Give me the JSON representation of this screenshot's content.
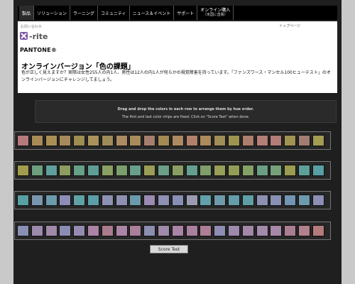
{
  "nav": {
    "items": [
      "製品",
      "ソリューション",
      "ラーニング",
      "コミュニティ",
      "ニュース＆イベント",
      "サポート"
    ],
    "shop_label": "オンライン購入",
    "shop_sub": "（米国に直販）"
  },
  "header": {
    "contact": "お問い合わせ",
    "top_link": "トップページ",
    "xrite_logo": "x·rite",
    "pantone_logo": "PANTONE®"
  },
  "intro": {
    "title": "オンラインバージョン「色の課題」",
    "body": "色が正しく見えますか？実際は女性255人の内1人、男性は12人の内1人が何らかの視覚障害を持っています。「ファンズワース・マンセル100ヒューテスト」のオンラインバージョンにチャレンジしてましょう。"
  },
  "instructions": {
    "line1": "Drag and drop the colors in each row to arrange them by hue order.",
    "line2": "The first and last color chips are fixed. Click on \"Score Test\" when done."
  },
  "rows": [
    [
      "#b57a7c",
      "#a98a56",
      "#a99052",
      "#a68a5c",
      "#9c8d50",
      "#a9935a",
      "#9e8b57",
      "#ac8b63",
      "#a78b5d",
      "#a77e6e",
      "#a38a52",
      "#ac8a5f",
      "#b27f6a",
      "#ab8a5b",
      "#a08e55",
      "#9e9450",
      "#ab7f6b",
      "#b47e74",
      "#b27c77",
      "#a19352",
      "#a27d73",
      "#a39c53"
    ],
    [
      "#a29d4e",
      "#6d9f7f",
      "#5fa09d",
      "#8c9d5f",
      "#67a089",
      "#5f9e95",
      "#8b9f62",
      "#7b9e6d",
      "#68a08b",
      "#9a9d55",
      "#6b9f86",
      "#8a9e63",
      "#64a090",
      "#7f9f6a",
      "#969f57",
      "#949d57",
      "#83a067",
      "#6b9f84",
      "#75a07a",
      "#9b9d50",
      "#5e9f97",
      "#58a0a3"
    ],
    [
      "#58a0a3",
      "#7996b1",
      "#6a9bac",
      "#8d8db7",
      "#5ea2a6",
      "#5a9ea9",
      "#8c91b4",
      "#8d91b1",
      "#6c9aad",
      "#9b8ab2",
      "#8e90b4",
      "#878fb5",
      "#999cb1",
      "#62a0ab",
      "#6e9aac",
      "#659daa",
      "#5e9fa7",
      "#8c91b4",
      "#8891b4",
      "#7195b3",
      "#6d9aae",
      "#8c8eb4"
    ],
    [
      "#8a8fb4",
      "#9e8aac",
      "#a18aa8",
      "#8b8cb3",
      "#958bb2",
      "#aa83a6",
      "#ab7b8d",
      "#ab85a6",
      "#ab7e9a",
      "#8c8db1",
      "#9f8aab",
      "#aa84a6",
      "#ab7f9e",
      "#ad7e96",
      "#8e8db3",
      "#9e8aad",
      "#a287a8",
      "#a38aab",
      "#a888a9",
      "#aa7d92",
      "#b1818d",
      "#b57a7c"
    ]
  ],
  "score_button": "Score Test"
}
